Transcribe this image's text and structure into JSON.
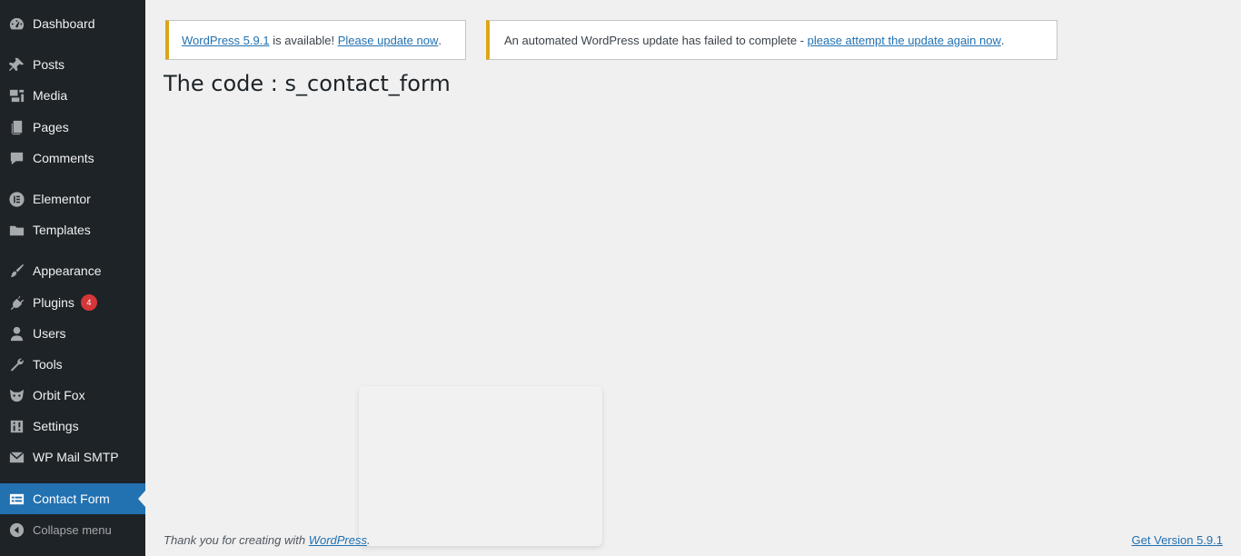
{
  "sidebar": {
    "items": [
      {
        "label": "Dashboard",
        "icon": "dashboard-icon"
      },
      {
        "label": "Posts",
        "icon": "pushpin-icon"
      },
      {
        "label": "Media",
        "icon": "media-icon"
      },
      {
        "label": "Pages",
        "icon": "pages-icon"
      },
      {
        "label": "Comments",
        "icon": "comment-icon"
      },
      {
        "label": "Elementor",
        "icon": "elementor-icon"
      },
      {
        "label": "Templates",
        "icon": "folder-icon"
      },
      {
        "label": "Appearance",
        "icon": "paintbrush-icon"
      },
      {
        "label": "Plugins",
        "icon": "plugin-icon",
        "badge": "4"
      },
      {
        "label": "Users",
        "icon": "user-icon"
      },
      {
        "label": "Tools",
        "icon": "wrench-icon"
      },
      {
        "label": "Orbit Fox",
        "icon": "fox-icon"
      },
      {
        "label": "Settings",
        "icon": "settings-icon"
      },
      {
        "label": "WP Mail SMTP",
        "icon": "mail-icon"
      },
      {
        "label": "Contact Form",
        "icon": "form-icon",
        "active": true
      },
      {
        "label": "Collapse menu",
        "icon": "collapse-arrow-icon"
      }
    ]
  },
  "notices": {
    "update": {
      "link1": "WordPress 5.9.1",
      "text": " is available! ",
      "link2": "Please update now",
      "end": "."
    },
    "failed": {
      "text": "An automated WordPress update has failed to complete - ",
      "link": "please attempt the update again now",
      "end": "."
    }
  },
  "page": {
    "title": "The code : s_contact_form"
  },
  "footer": {
    "thanks_prefix": "Thank you for creating with ",
    "thanks_link": "WordPress",
    "thanks_end": ".",
    "version": "Get Version 5.9.1"
  },
  "colors": {
    "sidebar_bg": "#1d2327",
    "accent": "#2271b1",
    "notice_warning": "#dba617",
    "badge": "#d63638"
  }
}
